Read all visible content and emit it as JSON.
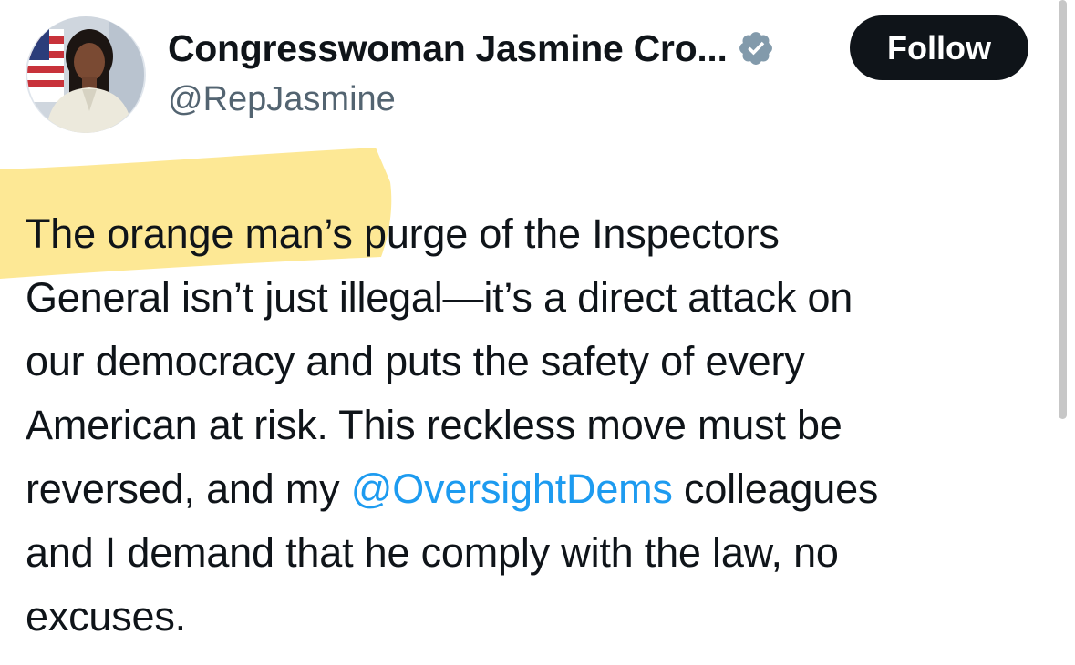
{
  "author": {
    "display_name": "Congresswoman Jasmine Cro...",
    "handle": "@RepJasmine",
    "avatar_icon": "profile-photo",
    "verified_icon": "verified-badge-icon",
    "verified_color": "#829aab"
  },
  "actions": {
    "follow_label": "Follow"
  },
  "tweet": {
    "lines": [
      {
        "text": "The orange man’s purge of the Inspectors"
      },
      {
        "text": "General isn’t just illegal—it’s a direct attack on"
      },
      {
        "text": "our democracy and puts the safety of every"
      },
      {
        "text": "American at risk. This reckless move must be"
      },
      {
        "before": "reversed, and my ",
        "mention": "@OversightDems",
        "after": " colleagues"
      },
      {
        "text": "and I demand that he comply with the law, no"
      },
      {
        "text": "excuses."
      }
    ],
    "highlighted_text": "The orange man’s",
    "highlight_color": "#fde68a",
    "mention_color": "#1d9bf0"
  }
}
